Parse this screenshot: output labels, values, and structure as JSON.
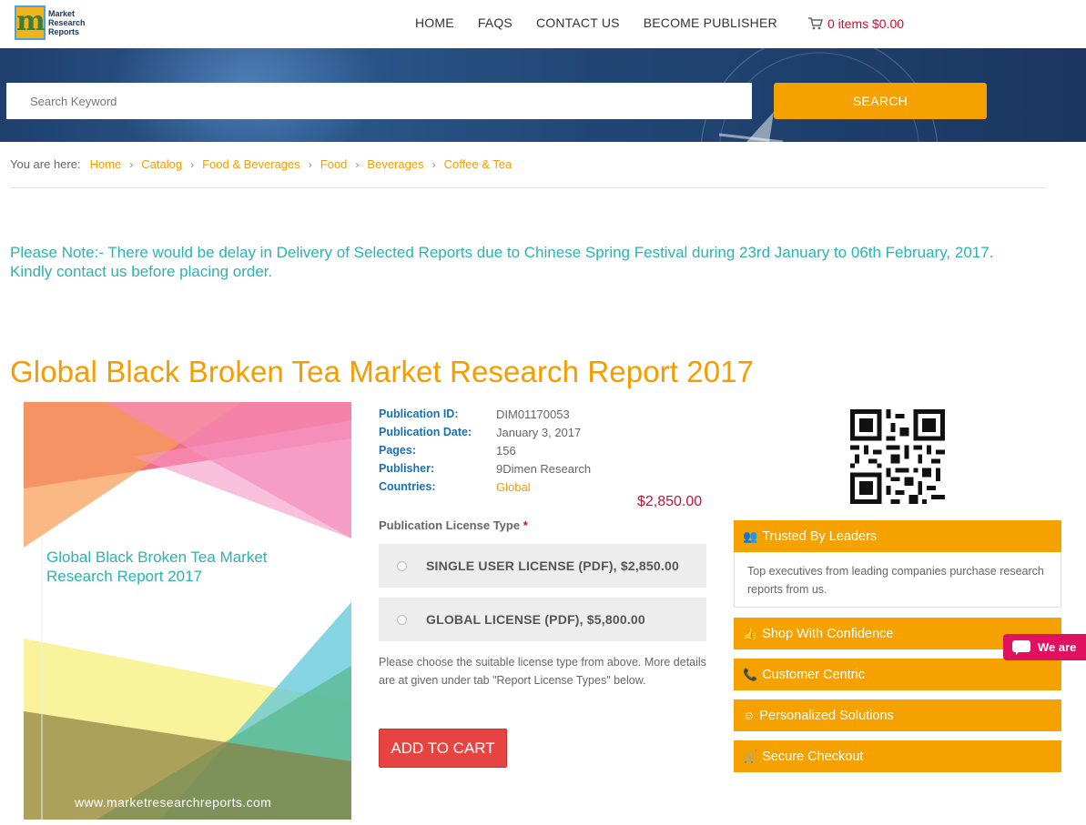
{
  "logo": {
    "line1": "Market",
    "line2": "Research",
    "line3": "Reports",
    "mark": "m"
  },
  "nav": {
    "items": [
      "HOME",
      "FAQS",
      "CONTACT US",
      "BECOME PUBLISHER"
    ]
  },
  "cart": {
    "label": "0 items $0.00",
    "icon": "shopping-cart-icon"
  },
  "search": {
    "placeholder": "Search Keyword",
    "button_label": "SEARCH"
  },
  "breadcrumb": {
    "label": "You are here:",
    "items": [
      "Home",
      "Catalog",
      "Food & Beverages",
      "Food",
      "Beverages",
      "Coffee & Tea"
    ]
  },
  "notice": "Please Note:- There would be delay in Delivery of Selected Reports due to Chinese Spring Festival during 23rd January to 06th February, 2017. Kindly contact us before placing order.",
  "report": {
    "title": "Global Black Broken Tea Market Research Report 2017",
    "cover_title": "Global Black Broken Tea Market Research Report 2017",
    "cover_url": "www.marketresearchreports.com",
    "details": [
      {
        "key": "Publication ID:",
        "value": "DIM01170053"
      },
      {
        "key": "Publication Date:",
        "value": "January 3, 2017"
      },
      {
        "key": "Pages:",
        "value": "156"
      },
      {
        "key": "Publisher:",
        "value": "9Dimen Research"
      },
      {
        "key": "Countries:",
        "value": "Global"
      }
    ],
    "price": "$2,850.00"
  },
  "license": {
    "title": "Publication License Type",
    "required_mark": "*",
    "options": [
      "SINGLE USER LICENSE (PDF), $2,850.00",
      "GLOBAL LICENSE (PDF), $5,800.00"
    ],
    "note": "Please choose the suitable license type from above. More details are at given under tab \"Report License Types\" below.",
    "add_to_cart": "ADD TO CART"
  },
  "sidebar": {
    "panels": [
      {
        "icon": "users-icon",
        "glyph": "👥",
        "title": "Trusted By Leaders"
      },
      {
        "icon": "thumbs-up-icon",
        "glyph": "👍",
        "title": "Shop With Confidence"
      },
      {
        "icon": "phone-icon",
        "glyph": "📞",
        "title": "Customer Centric"
      },
      {
        "icon": "smile-icon",
        "glyph": "☺",
        "title": "Personalized Solutions"
      },
      {
        "icon": "cart-icon",
        "glyph": "🛒",
        "title": "Secure Checkout"
      }
    ],
    "trusted_body": "Top executives from leading companies purchase research reports from us."
  },
  "chat": {
    "label": "We are"
  },
  "colors": {
    "accent": "#f5a200",
    "link": "#f59d00",
    "teal": "#2ab3b0",
    "price": "#c8102e",
    "button": "#e74340"
  }
}
